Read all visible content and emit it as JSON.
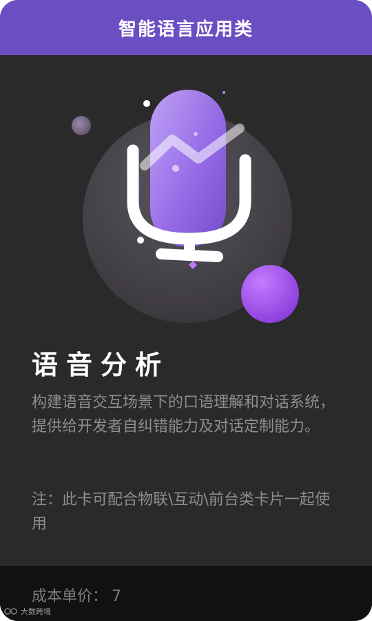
{
  "header": {
    "title": "智能语言应用类"
  },
  "hero": {
    "icon": "microphone-icon",
    "accent_colors": [
      "#6b4ec2",
      "#9b6cf5",
      "#b456f5"
    ]
  },
  "card": {
    "title": "语音分析",
    "description": "构建语音交互场景下的口语理解和对话系统，提供给开发者自纠错能力及对话定制能力。",
    "note": "注：此卡可配合物联\\互动\\前台类卡片一起使用"
  },
  "footer": {
    "price_label": "成本单价：",
    "price_value": "7"
  },
  "watermark": {
    "text": "大数跨境"
  }
}
